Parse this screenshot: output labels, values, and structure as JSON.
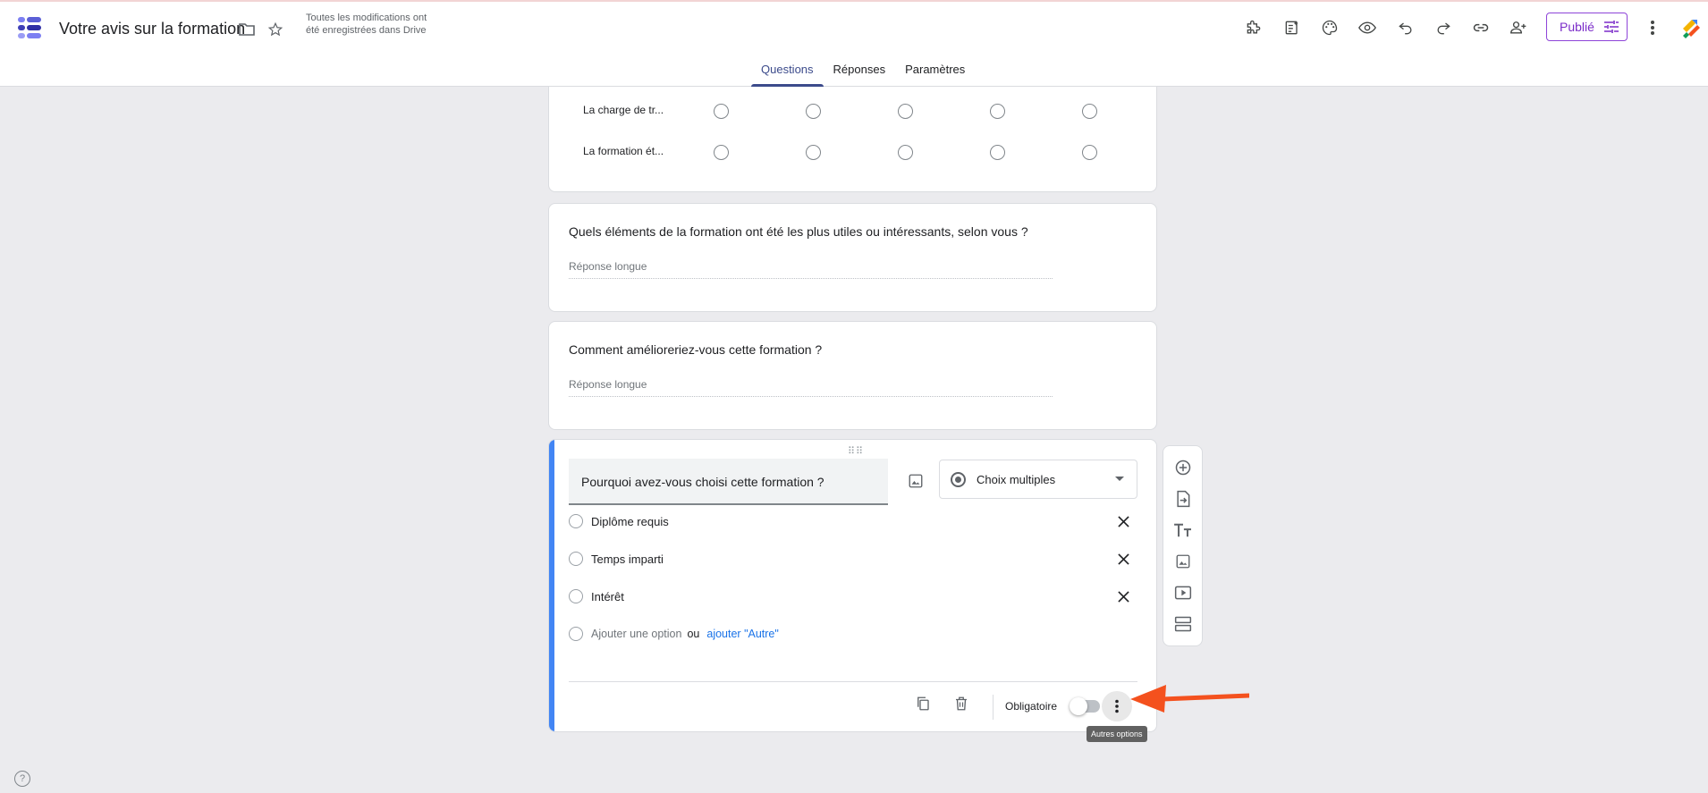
{
  "header": {
    "doc_title": "Votre avis sur la formation",
    "save_status": "Toutes les modifications ont été enregistrées dans Drive",
    "publish_label": "Publié",
    "icons": [
      "addons-icon",
      "customize-icon",
      "palette-icon",
      "preview-icon",
      "undo-icon",
      "redo-icon",
      "link-icon",
      "add-collaborator-icon",
      "more-vert-icon"
    ]
  },
  "tabs": [
    {
      "label": "Questions",
      "active": true
    },
    {
      "label": "Réponses",
      "active": false
    },
    {
      "label": "Paramètres",
      "active": false
    }
  ],
  "grid_card": {
    "rows": [
      "La charge de tr...",
      "La formation ét..."
    ],
    "columns_count": 5
  },
  "q_useful": {
    "title": "Quels éléments de la formation ont été les plus utiles ou intéressants, selon vous ?",
    "placeholder": "Réponse longue"
  },
  "q_improve": {
    "title": "Comment amélioreriez-vous cette formation ?",
    "placeholder": "Réponse longue"
  },
  "active_question": {
    "title": "Pourquoi avez-vous choisi cette formation ?",
    "type": "Choix multiples",
    "options": [
      "Diplôme requis",
      "Temps imparti",
      "Intérêt"
    ],
    "add_option": "Ajouter une option",
    "or": "ou",
    "add_other": "ajouter \"Autre\"",
    "required_label": "Obligatoire",
    "required": false,
    "tooltip": "Autres options"
  },
  "colors": {
    "accent": "#4285f4",
    "publish": "#7b2cc9",
    "arrow": "#f4511e"
  }
}
